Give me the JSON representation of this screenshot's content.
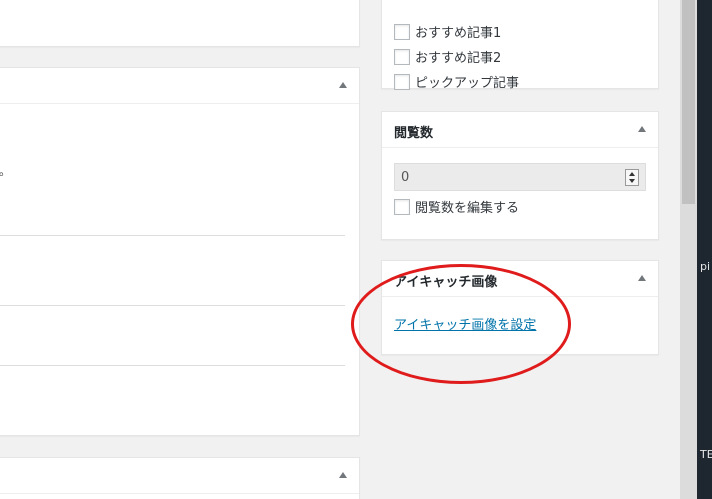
{
  "left_panel": {
    "fragment_text": "。"
  },
  "recommend_box": {
    "items": [
      {
        "label": "おすすめ記事1"
      },
      {
        "label": "おすすめ記事2"
      },
      {
        "label": "ピックアップ記事"
      }
    ]
  },
  "views_box": {
    "title": "閲覧数",
    "value": "0",
    "edit_label": "閲覧数を編集する"
  },
  "thumbnail_box": {
    "title": "アイキャッチ画像",
    "link_label": "アイキャッチ画像を設定"
  },
  "side_fragments": {
    "a": "pi",
    "b": "TE"
  },
  "colors": {
    "annotation_ellipse": "#e01b1b",
    "link": "#0073aa"
  }
}
